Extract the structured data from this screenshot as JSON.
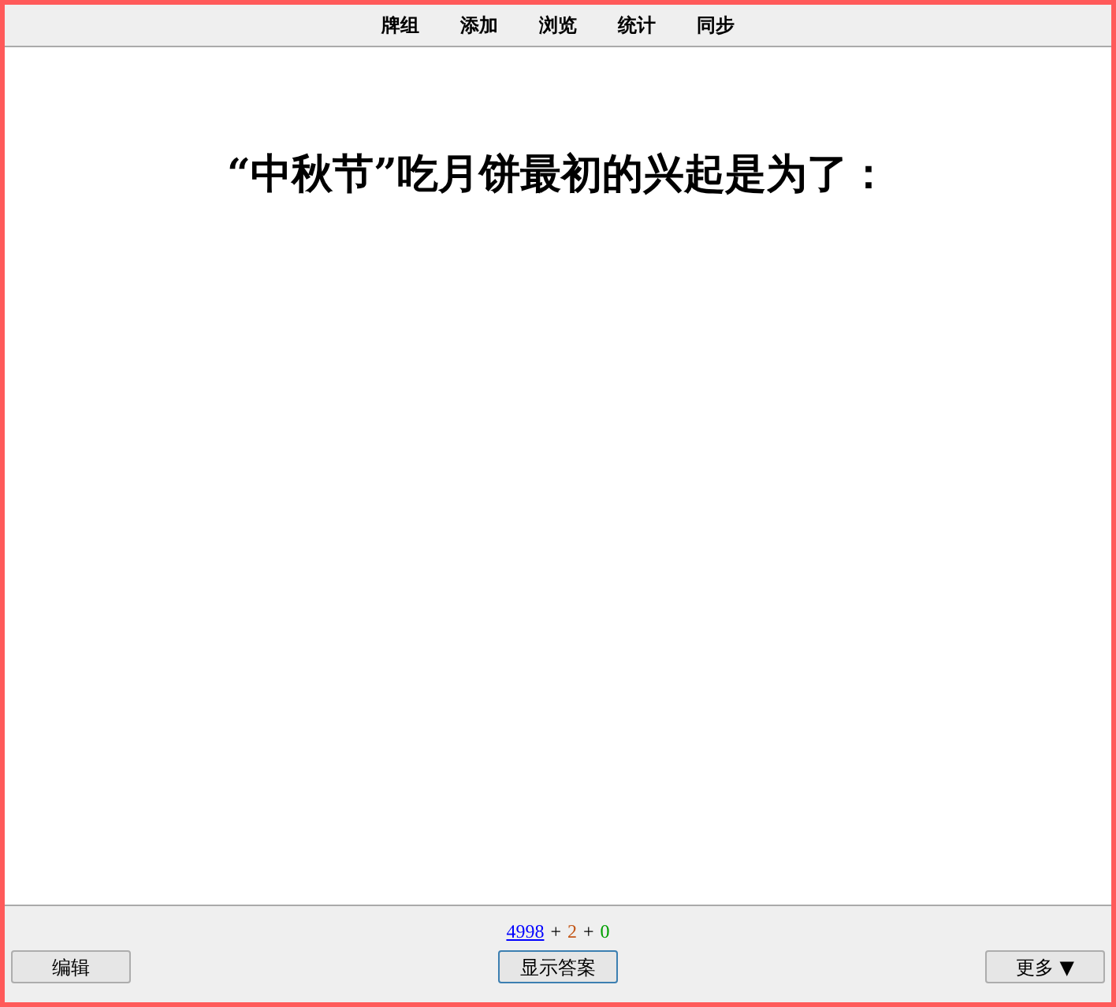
{
  "top_menu": [
    {
      "label": "牌组"
    },
    {
      "label": "添加"
    },
    {
      "label": "浏览"
    },
    {
      "label": "统计"
    },
    {
      "label": "同步"
    }
  ],
  "question": "“中秋节”吃月饼最初的兴起是为了：",
  "counts": [
    {
      "kind": "link",
      "text": "4998",
      "color": "#0000ff"
    },
    {
      "kind": "separator",
      "text": "+"
    },
    {
      "kind": "count",
      "text": "2",
      "color": "#c35617"
    },
    {
      "kind": "separator",
      "text": "+"
    },
    {
      "kind": "count",
      "text": "0",
      "color": "#00a000"
    }
  ],
  "buttons": {
    "edit": "编辑",
    "show_answer": "显示答案",
    "more": "更多 ▼"
  }
}
